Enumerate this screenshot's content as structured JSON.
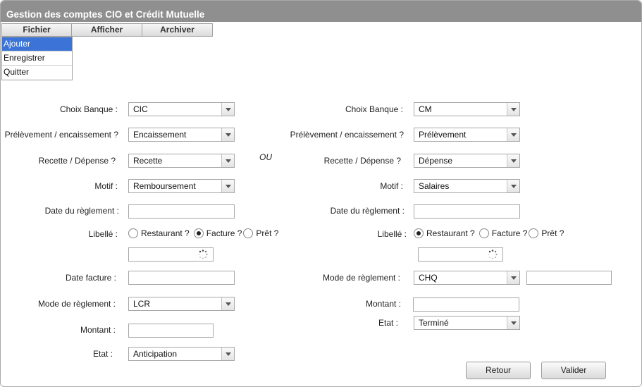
{
  "window": {
    "title": "Gestion des comptes CIO et Crédit Mutuelle"
  },
  "menubar": {
    "items": [
      "Fichier",
      "Afficher",
      "Archiver"
    ]
  },
  "dropdown": {
    "items": [
      "Ajouter",
      "Enregistrer",
      "Quitter"
    ],
    "active": "Ajouter"
  },
  "separator_label": "OU",
  "left": {
    "banque_label": "Choix Banque :",
    "banque_value": "CIC",
    "prelev_label": "Prélèvement / encaissement ?",
    "prelev_value": "Encaissement",
    "recette_label": "Recette / Dépense ?",
    "recette_value": "Recette",
    "motif_label": "Motif :",
    "motif_value": "Remboursement",
    "date_reglement_label": "Date du règlement :",
    "date_reglement_value": "",
    "libelle_label": "Libellé :",
    "libelle_options": [
      "Restaurant ?",
      "Facture ?",
      "Prêt ?"
    ],
    "libelle_selected": "Facture ?",
    "date_facture_label": "Date facture :",
    "date_facture_value": "",
    "mode_label": "Mode de règlement :",
    "mode_value": "LCR",
    "montant_label": "Montant :",
    "montant_value": "",
    "etat_label": "Etat :",
    "etat_value": "Anticipation"
  },
  "right": {
    "banque_label": "Choix Banque :",
    "banque_value": "CM",
    "prelev_label": "Prélèvement / encaissement ?",
    "prelev_value": "Prélèvement",
    "recette_label": "Recette / Dépense ?",
    "recette_value": "Dépense",
    "motif_label": "Motif :",
    "motif_value": "Salaires",
    "date_reglement_label": "Date du règlement :",
    "date_reglement_value": "",
    "libelle_label": "Libellé :",
    "libelle_options": [
      "Restaurant ?",
      "Facture ?",
      "Prêt ?"
    ],
    "libelle_selected": "Restaurant ?",
    "mode_label": "Mode de règlement :",
    "mode_value": "CHQ",
    "mode_extra_value": "",
    "montant_label": "Montant :",
    "montant_value": "",
    "etat_label": "Etat :",
    "etat_value": "Terminé"
  },
  "buttons": {
    "retour": "Retour",
    "valider": "Valider"
  },
  "colors": {
    "titlebar": "#8f8f8f",
    "menu_active": "#3b74d6"
  }
}
